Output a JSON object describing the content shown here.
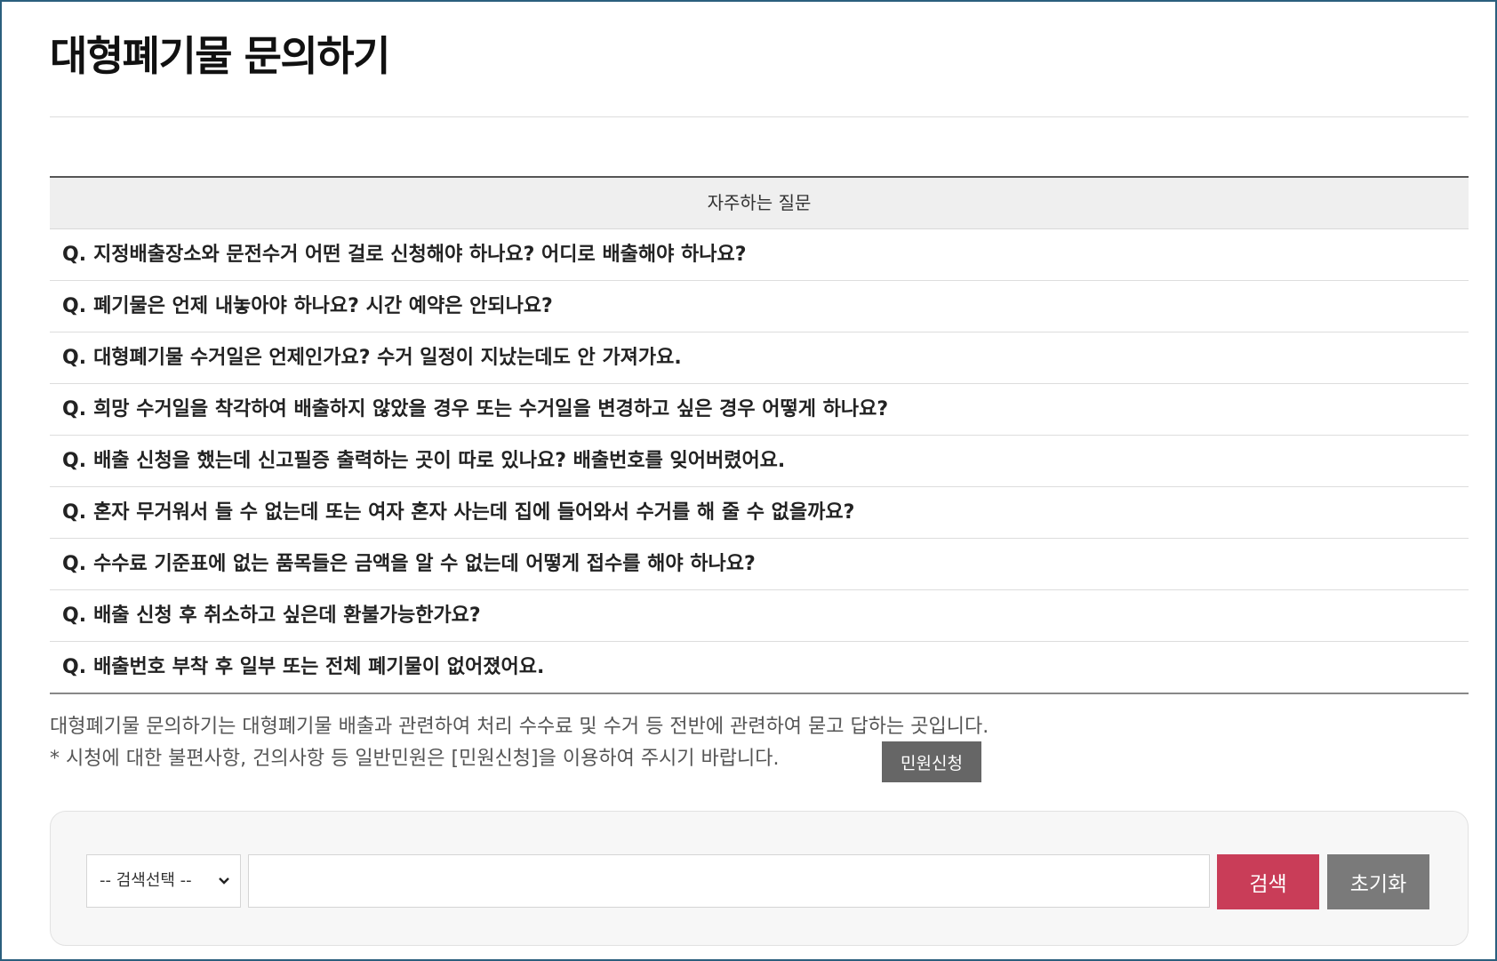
{
  "page": {
    "title": "대형폐기물 문의하기"
  },
  "faq": {
    "header": "자주하는 질문",
    "q_marker": "Q.",
    "items": [
      "지정배출장소와 문전수거 어떤 걸로 신청해야 하나요? 어디로 배출해야 하나요?",
      "폐기물은 언제 내놓아야 하나요? 시간 예약은 안되나요?",
      "대형폐기물 수거일은 언제인가요? 수거 일정이 지났는데도 안 가져가요.",
      "희망 수거일을 착각하여 배출하지 않았을 경우 또는 수거일을 변경하고 싶은 경우 어떻게 하나요?",
      "배출 신청을 했는데 신고필증 출력하는 곳이 따로 있나요? 배출번호를 잊어버렸어요.",
      "혼자 무거워서 들 수 없는데 또는 여자 혼자 사는데 집에 들어와서 수거를 해 줄 수 없을까요?",
      "수수료 기준표에 없는 품목들은 금액을 알 수 없는데 어떻게 접수를 해야 하나요?",
      "배출 신청 후 취소하고 싶은데 환불가능한가요?",
      "배출번호 부착 후 일부 또는 전체 폐기물이 없어졌어요."
    ]
  },
  "notice": {
    "line1": "대형폐기물 문의하기는 대형폐기물 배출과 관련하여 처리 수수료 및 수거 등 전반에 관련하여 묻고 답하는 곳입니다.",
    "line2": "* 시청에 대한 불편사항, 건의사항 등 일반민원은 [민원신청]을 이용하여 주시기 바랍니다.",
    "button_label": "민원신청"
  },
  "search": {
    "select_value": "-- 검색선택 --",
    "input_value": "",
    "search_label": "검색",
    "reset_label": "초기화"
  },
  "colors": {
    "frame_border": "#2a5f7d",
    "search_button": "#c93d58",
    "reset_button": "#7a7a7a",
    "civil_button": "#666666"
  },
  "icons": {
    "select_chevron": "chevron-down-icon"
  }
}
